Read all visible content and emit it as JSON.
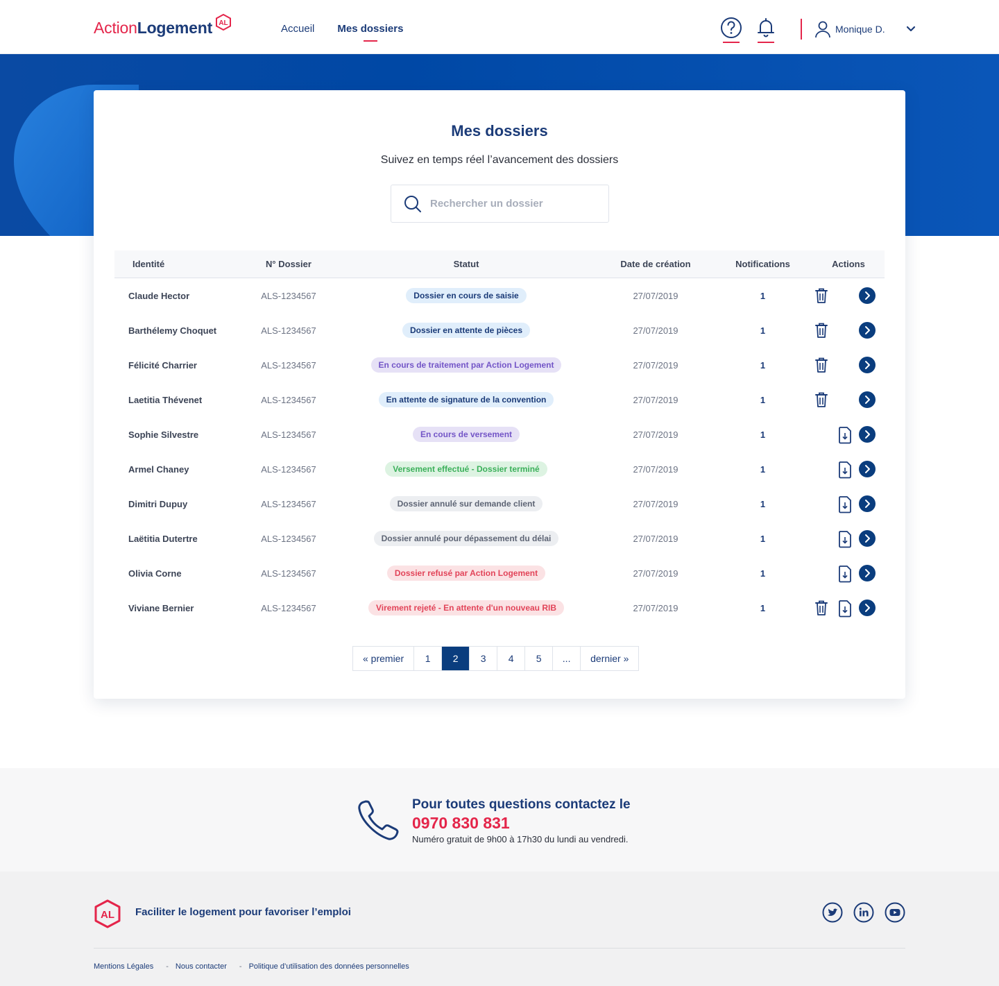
{
  "header": {
    "logo_part1": "Action",
    "logo_part2": "Logement",
    "logo_mark": "AL",
    "nav": [
      {
        "label": "Accueil",
        "active": false
      },
      {
        "label": "Mes dossiers",
        "active": true
      }
    ],
    "help_icon": "question-circle-icon",
    "notif_icon": "bell-icon",
    "user_name": "Monique D."
  },
  "page": {
    "title": "Mes dossiers",
    "subtitle": "Suivez en temps réel l’avancement des dossiers",
    "search_placeholder": "Rechercher un dossier"
  },
  "table": {
    "headers": {
      "identity": "Identité",
      "number": "N° Dossier",
      "status": "Statut",
      "date": "Date de création",
      "notifications": "Notifications",
      "actions": "Actions"
    },
    "rows": [
      {
        "identity": "Claude Hector",
        "number": "ALS-1234567",
        "status": "Dossier en cours de saisie",
        "status_color": "blue",
        "date": "27/07/2019",
        "notifications": "1",
        "trash": true,
        "download": false
      },
      {
        "identity": "Barthélemy Choquet",
        "number": "ALS-1234567",
        "status": "Dossier en attente de pièces",
        "status_color": "blue",
        "date": "27/07/2019",
        "notifications": "1",
        "trash": true,
        "download": false
      },
      {
        "identity": "Félicité Charrier",
        "number": "ALS-1234567",
        "status": "En cours de traitement par Action Logement",
        "status_color": "purple",
        "date": "27/07/2019",
        "notifications": "1",
        "trash": true,
        "download": false
      },
      {
        "identity": "Laetitia Thévenet",
        "number": "ALS-1234567",
        "status": "En attente de signature de la convention",
        "status_color": "blue",
        "date": "27/07/2019",
        "notifications": "1",
        "trash": true,
        "download": false
      },
      {
        "identity": "Sophie Silvestre",
        "number": "ALS-1234567",
        "status": "En cours de versement",
        "status_color": "purple",
        "date": "27/07/2019",
        "notifications": "1",
        "trash": false,
        "download": true
      },
      {
        "identity": "Armel Chaney",
        "number": "ALS-1234567",
        "status": "Versement effectué - Dossier terminé",
        "status_color": "green",
        "date": "27/07/2019",
        "notifications": "1",
        "trash": false,
        "download": true
      },
      {
        "identity": "Dimitri Dupuy",
        "number": "ALS-1234567",
        "status": "Dossier annulé sur demande client",
        "status_color": "grey",
        "date": "27/07/2019",
        "notifications": "1",
        "trash": false,
        "download": true
      },
      {
        "identity": "Laëtitia Dutertre",
        "number": "ALS-1234567",
        "status": "Dossier annulé pour dépassement du délai",
        "status_color": "grey",
        "date": "27/07/2019",
        "notifications": "1",
        "trash": false,
        "download": true
      },
      {
        "identity": "Olivia Corne",
        "number": "ALS-1234567",
        "status": "Dossier refusé par Action Logement",
        "status_color": "red",
        "date": "27/07/2019",
        "notifications": "1",
        "trash": false,
        "download": true
      },
      {
        "identity": "Viviane Bernier",
        "number": "ALS-1234567",
        "status": "Virement rejeté - En attente d'un nouveau RIB",
        "status_color": "red",
        "date": "27/07/2019",
        "notifications": "1",
        "trash": true,
        "download": true
      }
    ]
  },
  "pagination": {
    "first": "« premier",
    "pages": [
      "1",
      "2",
      "3",
      "4",
      "5",
      "..."
    ],
    "current": "2",
    "last": "dernier »"
  },
  "contact": {
    "title": "Pour toutes questions contactez le",
    "phone": "0970 830 831",
    "note": "Numéro gratuit de 9h00 à 17h30 du lundi au vendredi."
  },
  "footer": {
    "tagline": "Faciliter le logement pour favoriser l’emploi",
    "social": [
      "twitter-icon",
      "linkedin-icon",
      "youtube-icon"
    ],
    "links": [
      "Mentions Légales",
      "Nous contacter",
      "Politique d’utilisation des données personnelles"
    ]
  },
  "colors": {
    "brand_red": "#e4254a",
    "brand_navy": "#1b3b78",
    "hero_blue": "#0048a5",
    "active_page": "#0a3d7e"
  }
}
